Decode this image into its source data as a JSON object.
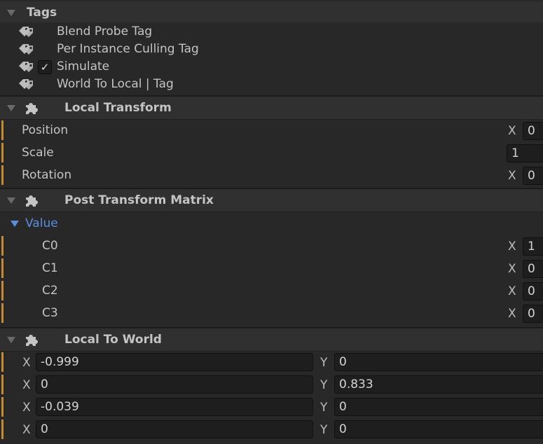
{
  "tags": {
    "title": "Tags",
    "items": [
      {
        "label": "Blend Probe Tag",
        "checked": false
      },
      {
        "label": "Per Instance Culling Tag",
        "checked": false
      },
      {
        "label": "Simulate",
        "checked": true
      },
      {
        "label": "World To Local | Tag",
        "checked": false
      }
    ]
  },
  "local_transform": {
    "title": "Local Transform",
    "position": {
      "label": "Position",
      "axis": "X",
      "value": "0"
    },
    "scale": {
      "label": "Scale",
      "value": "1"
    },
    "rotation": {
      "label": "Rotation",
      "axis": "X",
      "value": "0"
    }
  },
  "post_transform_matrix": {
    "title": "Post Transform Matrix",
    "value_label": "Value",
    "rows": [
      {
        "label": "C0",
        "axis": "X",
        "value": "1"
      },
      {
        "label": "C1",
        "axis": "X",
        "value": "0"
      },
      {
        "label": "C2",
        "axis": "X",
        "value": "0"
      },
      {
        "label": "C3",
        "axis": "X",
        "value": "0"
      }
    ]
  },
  "local_to_world": {
    "title": "Local To World",
    "rows": [
      {
        "x_axis": "X",
        "x": "-0.999",
        "y_axis": "Y",
        "y": "0"
      },
      {
        "x_axis": "X",
        "x": "0",
        "y_axis": "Y",
        "y": "0.833"
      },
      {
        "x_axis": "X",
        "x": "-0.039",
        "y_axis": "Y",
        "y": "0"
      },
      {
        "x_axis": "X",
        "x": "0",
        "y_axis": "Y",
        "y": "0"
      }
    ]
  },
  "icons": {
    "tag": "tag-icon",
    "component": "puzzle-piece-icon",
    "foldout": "triangle-down-icon",
    "check": "check-icon"
  },
  "colors": {
    "accent_bar": "#c88a2e",
    "foldout_blue": "#5a8fe0"
  }
}
